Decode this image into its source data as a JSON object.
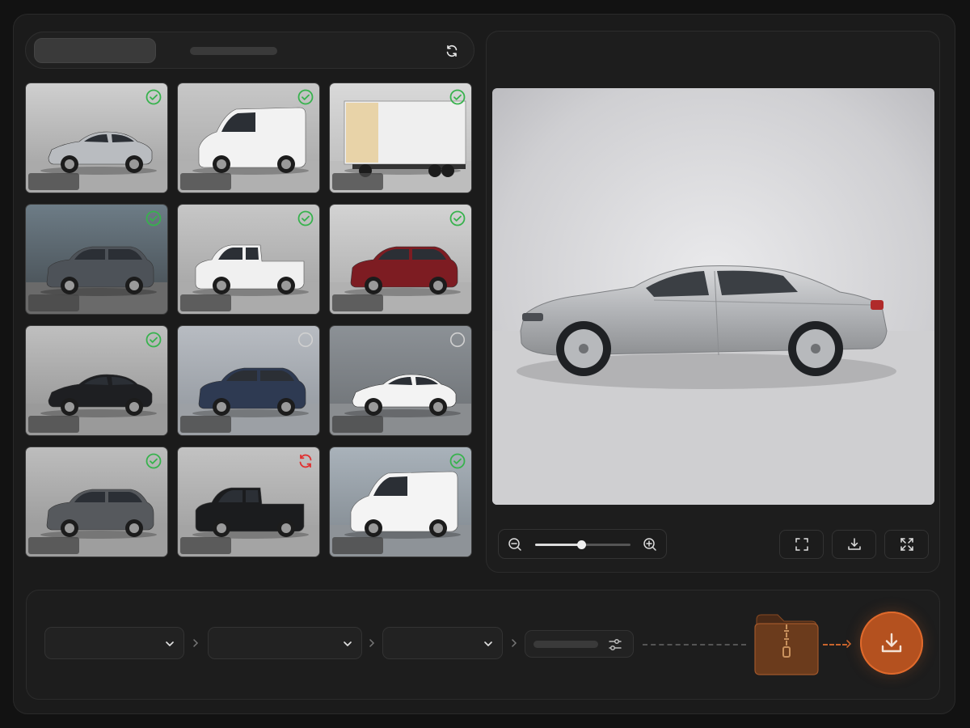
{
  "topbar": {
    "pill_text": "",
    "bar_text": ""
  },
  "gallery": {
    "cards": [
      {
        "label": "",
        "status": "done",
        "vehicle": "silver-sedan"
      },
      {
        "label": "",
        "status": "done",
        "vehicle": "white-cargo-van"
      },
      {
        "label": "",
        "status": "done",
        "vehicle": "box-truck"
      },
      {
        "label": "",
        "status": "done",
        "vehicle": "gray-suv"
      },
      {
        "label": "",
        "status": "done",
        "vehicle": "white-pickup"
      },
      {
        "label": "",
        "status": "done",
        "vehicle": "red-suv"
      },
      {
        "label": "",
        "status": "done",
        "vehicle": "black-sedan"
      },
      {
        "label": "",
        "status": "pending",
        "vehicle": "blue-suv"
      },
      {
        "label": "",
        "status": "pending",
        "vehicle": "white-sedan"
      },
      {
        "label": "",
        "status": "done",
        "vehicle": "gray-crossover"
      },
      {
        "label": "",
        "status": "error",
        "vehicle": "black-pickup"
      },
      {
        "label": "",
        "status": "done",
        "vehicle": "white-minivan"
      }
    ]
  },
  "preview": {
    "vehicle": "silver-sedan",
    "zoom_level": 0.48
  },
  "pipeline": {
    "step1_value": "",
    "step2_value": "",
    "step3_value": "",
    "filter_text": ""
  },
  "colors": {
    "status_done": "#37b24d",
    "status_pending": "#d0d0d0",
    "status_error": "#e03131",
    "accent": "#e06a2c"
  }
}
